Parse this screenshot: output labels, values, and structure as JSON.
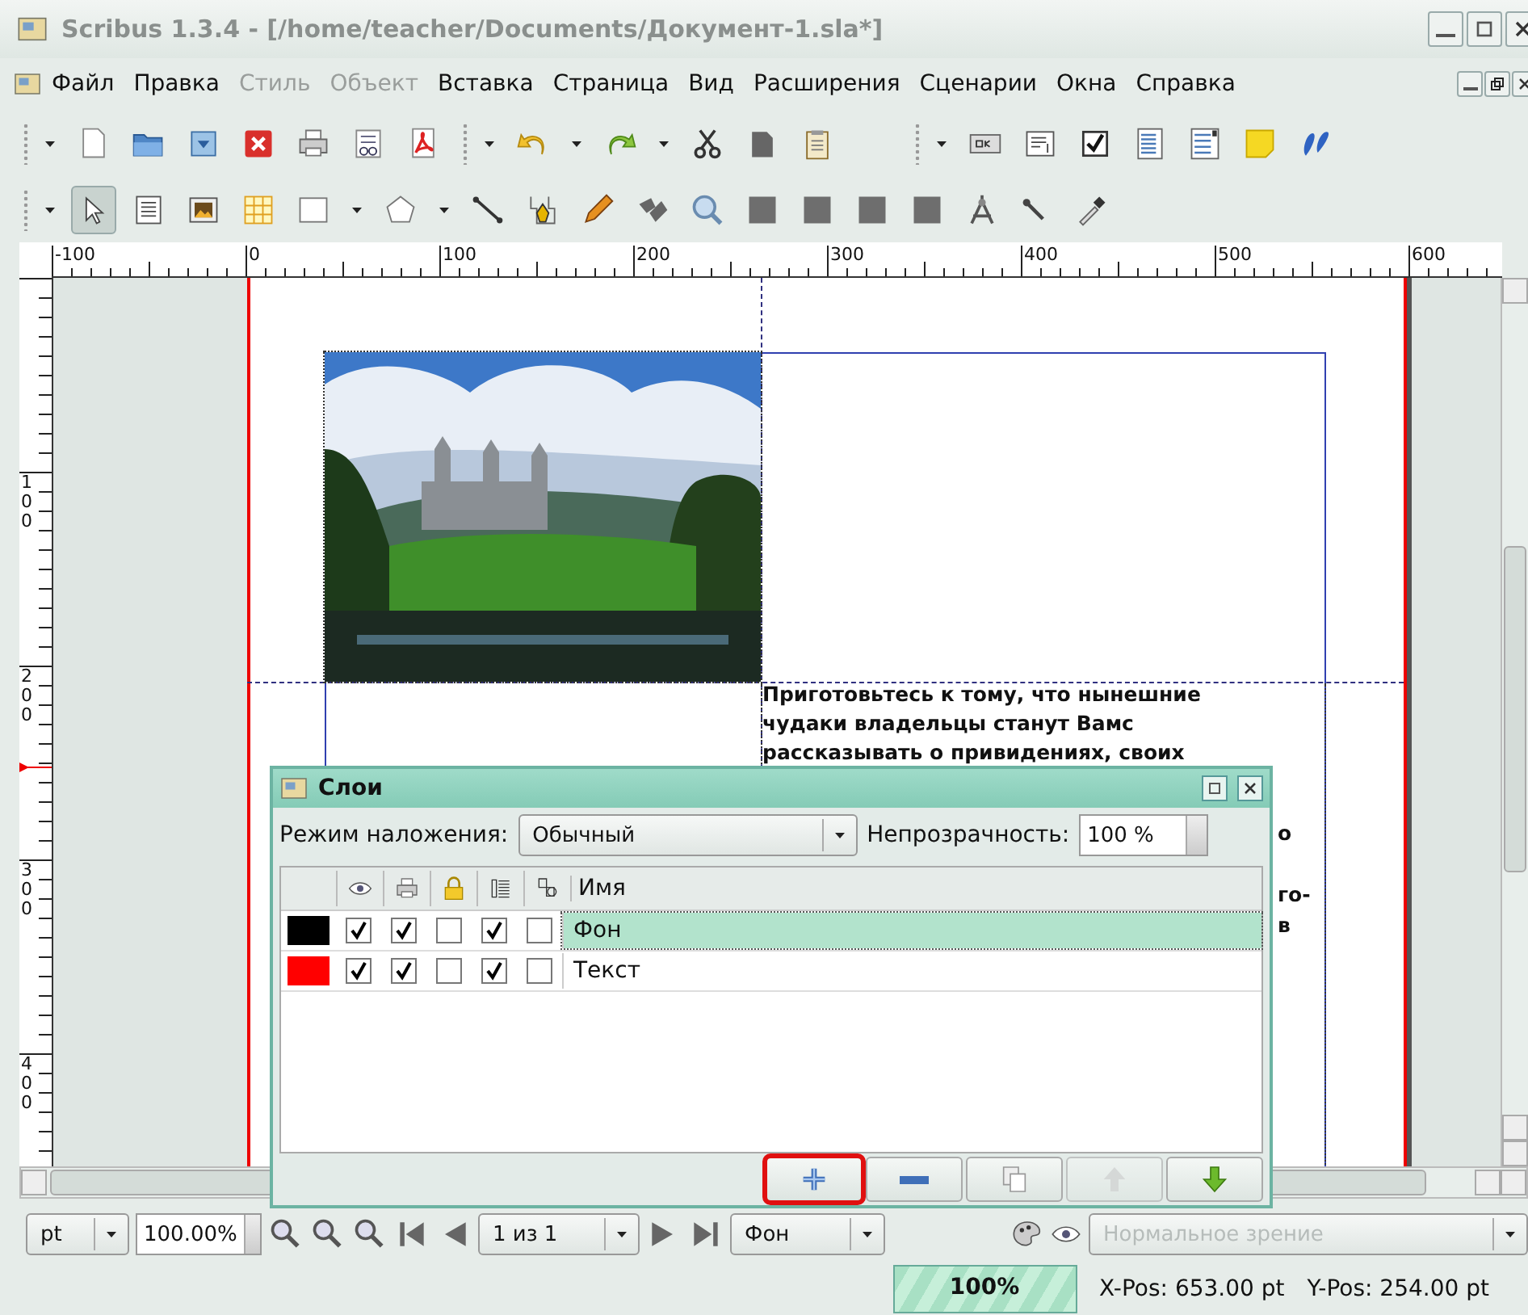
{
  "window": {
    "title": "Scribus 1.3.4 - [/home/teacher/Documents/Документ-1.sla*]"
  },
  "menu": [
    {
      "label": "Файл",
      "disabled": false
    },
    {
      "label": "Правка",
      "disabled": false
    },
    {
      "label": "Стиль",
      "disabled": true
    },
    {
      "label": "Объект",
      "disabled": true
    },
    {
      "label": "Вставка",
      "disabled": false
    },
    {
      "label": "Страница",
      "disabled": false
    },
    {
      "label": "Вид",
      "disabled": false
    },
    {
      "label": "Расширения",
      "disabled": false
    },
    {
      "label": "Сценарии",
      "disabled": false
    },
    {
      "label": "Окна",
      "disabled": false
    },
    {
      "label": "Справка",
      "disabled": false
    }
  ],
  "rulers": {
    "horizontal": [
      "-100",
      "0",
      "100",
      "200",
      "300",
      "400",
      "500",
      "600"
    ],
    "vertical": [
      "100",
      "200",
      "300",
      "400"
    ]
  },
  "canvas": {
    "text_frame": {
      "lines": [
        "Приготовьтесь к тому, что нынешние",
        "чудаки владельцы станут Вамс",
        "рассказывать о привидениях, своих"
      ],
      "fragments": [
        "о",
        "го-",
        "в"
      ]
    }
  },
  "layers_dialog": {
    "title": "Слои",
    "blend_label": "Режим наложения:",
    "blend_value": "Обычный",
    "opacity_label": "Непрозрачность:",
    "opacity_value": "100 %",
    "name_header": "Имя",
    "layers": [
      {
        "name": "Фон",
        "color": "#000000",
        "selected": true,
        "visible": true,
        "printable": true,
        "locked": false,
        "flow": true,
        "outline": false
      },
      {
        "name": "Текст",
        "color": "#ff0000",
        "selected": false,
        "visible": true,
        "printable": true,
        "locked": false,
        "flow": true,
        "outline": false
      }
    ],
    "buttons": [
      {
        "kind": "add",
        "disabled": false,
        "highlighted": true
      },
      {
        "kind": "remove",
        "disabled": false,
        "highlighted": false
      },
      {
        "kind": "duplicate",
        "disabled": false,
        "highlighted": false
      },
      {
        "kind": "raise",
        "disabled": true,
        "highlighted": false
      },
      {
        "kind": "lower",
        "disabled": false,
        "highlighted": false
      }
    ]
  },
  "bottom_bar": {
    "unit": "pt",
    "zoom": "100.00%",
    "page": "1 из 1",
    "layer": "Фон",
    "view_mode": "Нормальное зрение",
    "view_mode_disabled": true
  },
  "status_bar": {
    "progress": {
      "label": "100%",
      "level": 1
    },
    "x_pos": "X-Pos: 653.00 pt",
    "y_pos": "Y-Pos: 254.00 pt"
  }
}
